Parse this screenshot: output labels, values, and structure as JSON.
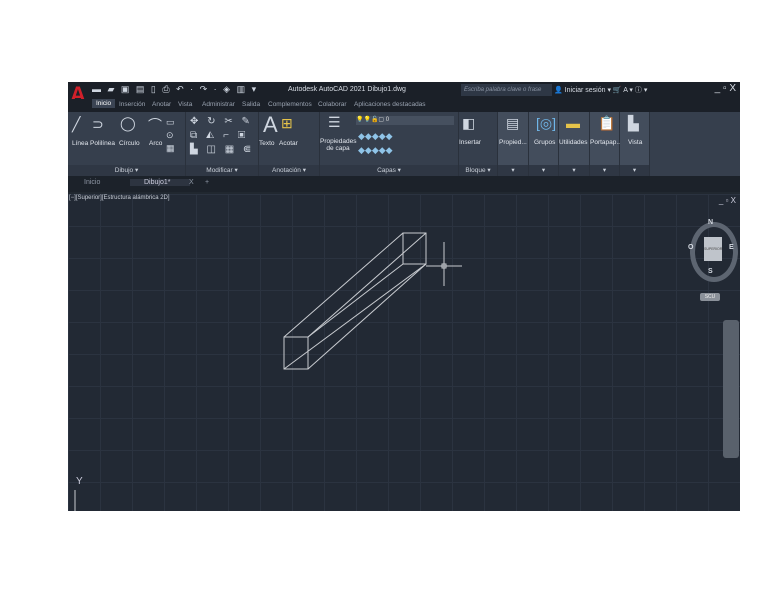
{
  "title_bar": {
    "app_title": "Autodesk AutoCAD 2021   Dibujo1.dwg",
    "search_placeholder": "Escriba palabra clave o frase",
    "sign_in": "Iniciar sesión",
    "window_controls": "_ ▫ X",
    "logo": "A"
  },
  "menu_tabs": [
    "Inicio",
    "Inserción",
    "Anotar",
    "Vista",
    "Administrar",
    "Salida",
    "Complementos",
    "Colaborar",
    "Aplicaciones destacadas"
  ],
  "ribbon": {
    "dibujo": {
      "label": "Dibujo ▾",
      "tools": [
        "Línea",
        "Polilínea",
        "Círculo",
        "Arco"
      ]
    },
    "modificar": {
      "label": "Modificar ▾"
    },
    "anotacion": {
      "label": "Anotación ▾",
      "tools": [
        "Texto",
        "Acotar"
      ]
    },
    "capas": {
      "label": "Capas ▾",
      "tool": "Propiedades de capa",
      "layer_value": "0"
    },
    "bloque": {
      "label": "Bloque ▾",
      "tool": "Insertar"
    },
    "extra": [
      "Propied...",
      "Grupos",
      "Utilidades",
      "Portapap...",
      "Vista"
    ]
  },
  "doc_tabs": {
    "home": "Inicio",
    "current": "Dibujo1*",
    "close": "X",
    "add": "+"
  },
  "viewport": {
    "label": "[−][Superior][Estructura alámbrica 2D]",
    "controls": "_ ▫ X",
    "y_axis": "Y"
  },
  "viewcube": {
    "n": "N",
    "s": "S",
    "e": "E",
    "o": "O",
    "face": "SUPERIOR",
    "ucs": "SCU"
  }
}
